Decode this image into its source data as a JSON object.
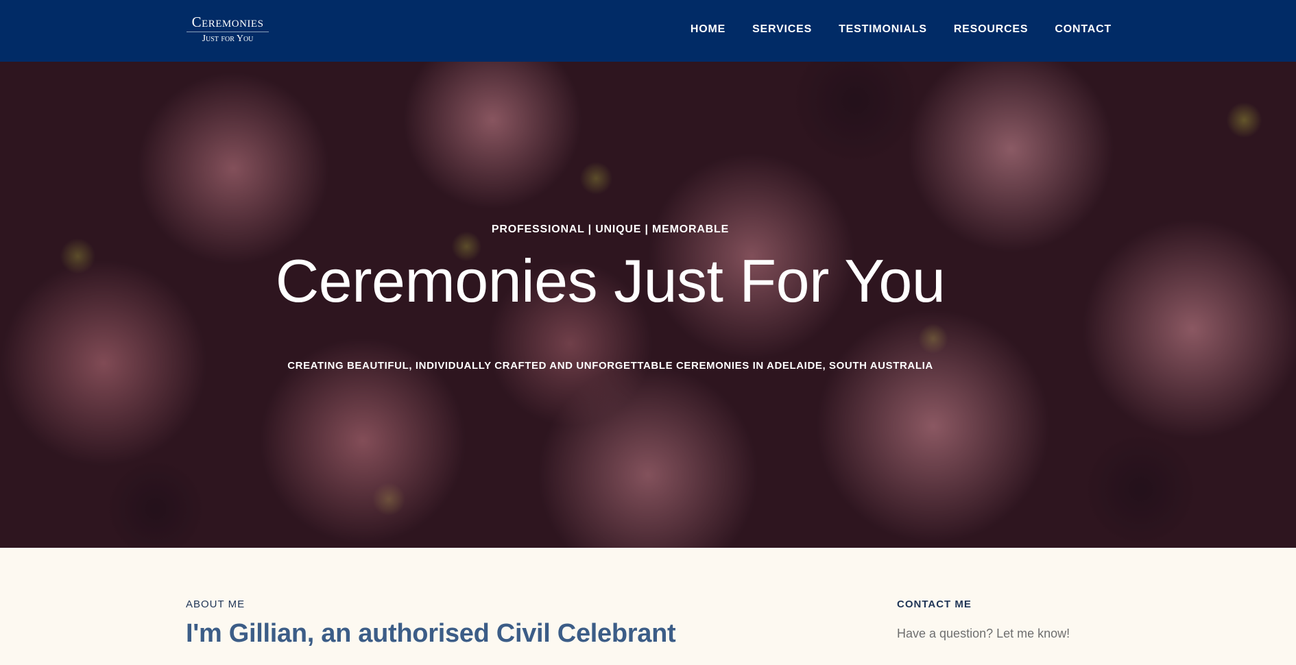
{
  "header": {
    "logo": {
      "line1": "Ceremonies",
      "line2": "Just for You"
    },
    "nav": [
      "HOME",
      "SERVICES",
      "TESTIMONIALS",
      "RESOURCES",
      "CONTACT"
    ]
  },
  "hero": {
    "tagline": "PROFESSIONAL | UNIQUE | MEMORABLE",
    "title": "Ceremonies Just For You",
    "subtitle": "CREATING BEAUTIFUL, INDIVIDUALLY CRAFTED AND UNFORGETTABLE CEREMONIES IN ADELAIDE, SOUTH AUSTRALIA"
  },
  "about": {
    "label": "ABOUT ME",
    "heading": "I'm Gillian, an authorised Civil Celebrant"
  },
  "contact": {
    "label": "CONTACT ME",
    "text": "Have a question? Let me know!"
  },
  "colors": {
    "header_bg": "#012b66",
    "page_bg": "#fdf9f1",
    "heading_blue": "#3c5d87",
    "label_navy": "#1f3556"
  }
}
